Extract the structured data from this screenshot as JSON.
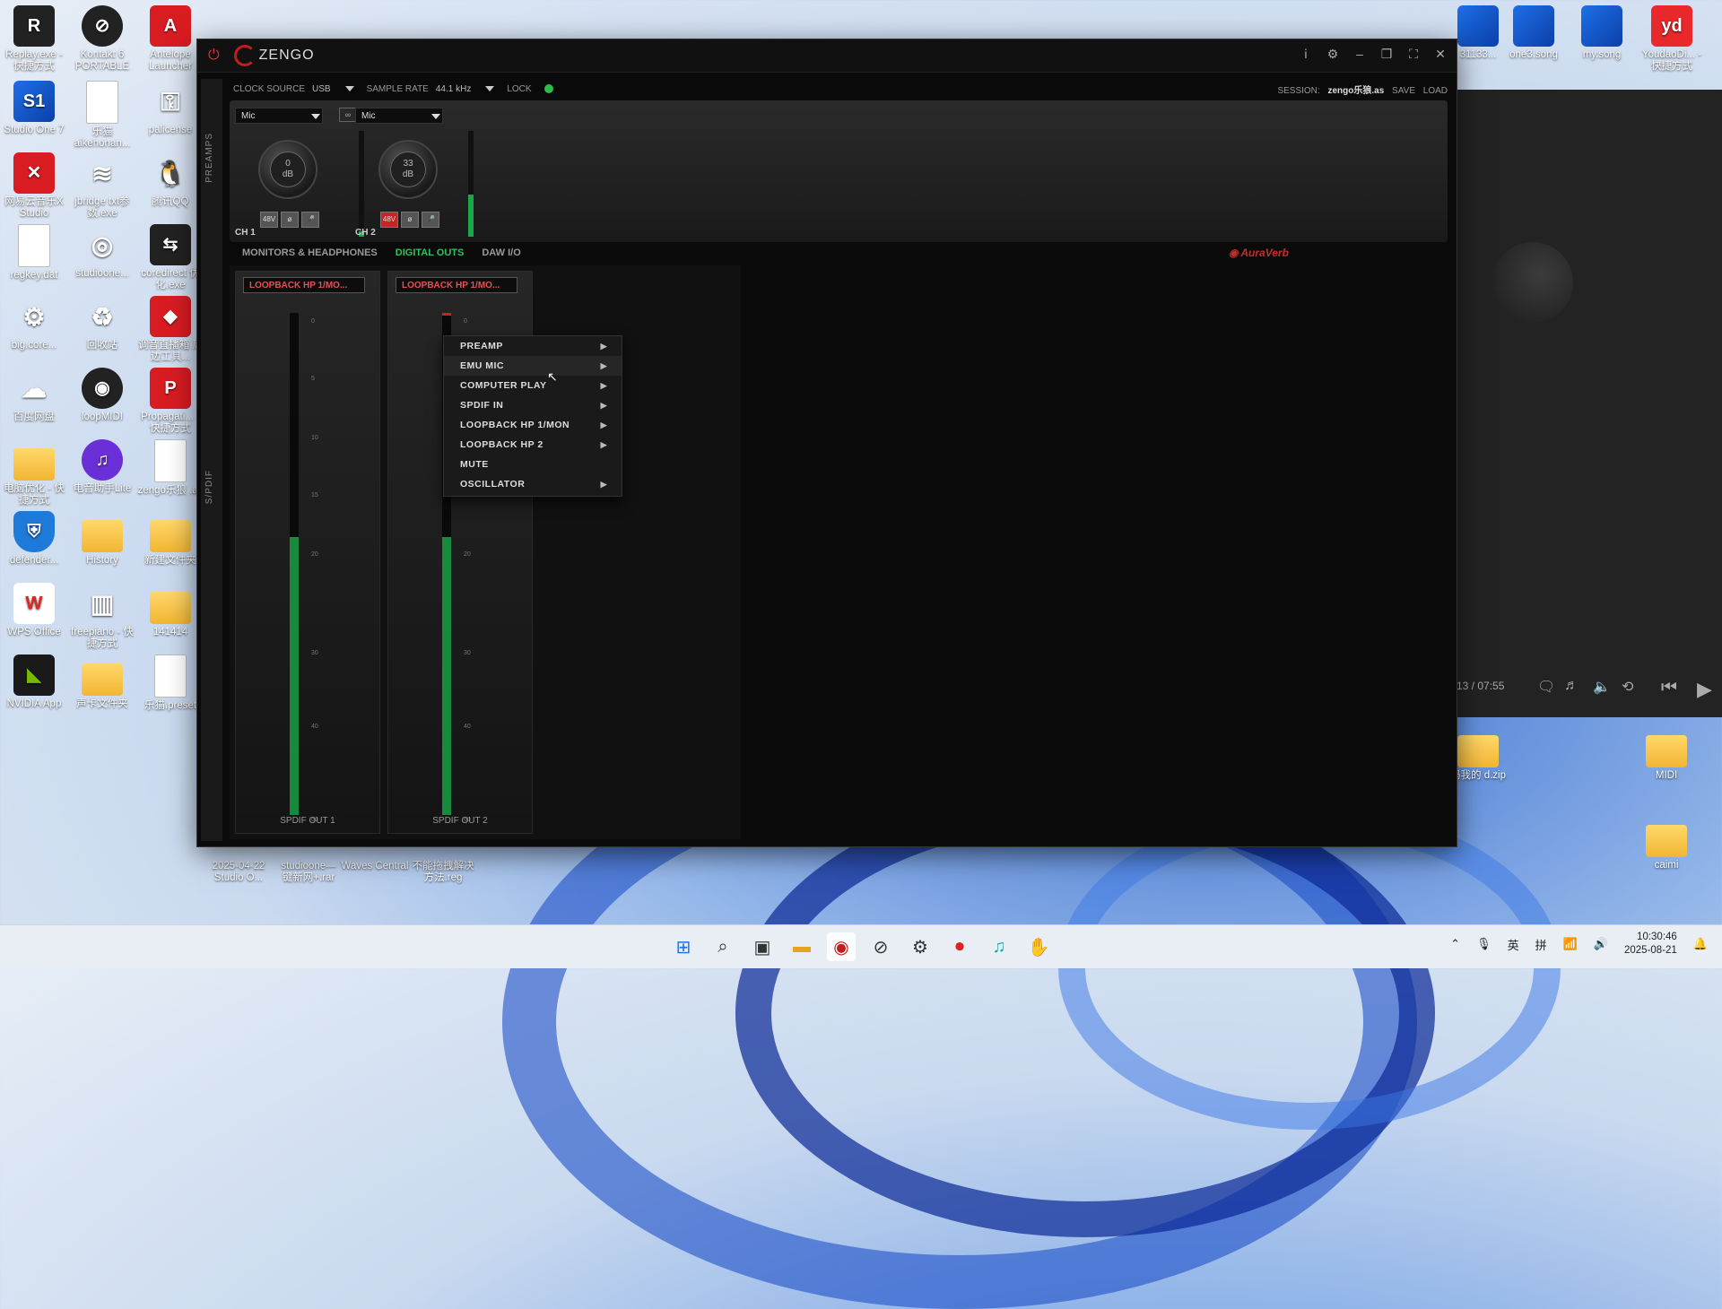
{
  "desktop": {
    "left_icons": [
      {
        "label": "Replay.exe - 快捷方式",
        "glyph": "R",
        "style": "dark-sq"
      },
      {
        "label": "Kontakt 6 PORTABLE",
        "glyph": "⊘",
        "style": "dark"
      },
      {
        "label": "Antelope Launcher",
        "glyph": "A",
        "style": "red"
      },
      {
        "label": "Studio One 7",
        "glyph": "S1",
        "style": "blue"
      },
      {
        "label": "乐猫 aikehonan...",
        "glyph": "",
        "style": "file"
      },
      {
        "label": "palicense",
        "glyph": "⚿",
        "style": "plain"
      },
      {
        "label": "网易云音乐X Studio",
        "glyph": "✕",
        "style": "red"
      },
      {
        "label": "jbridge txt参数.exe",
        "glyph": "≋",
        "style": "plain"
      },
      {
        "label": "腾讯QQ",
        "glyph": "🐧",
        "style": "plain"
      },
      {
        "label": "regkey.dat",
        "glyph": "",
        "style": "file"
      },
      {
        "label": "studioone...",
        "glyph": "◎",
        "style": "plain"
      },
      {
        "label": "coredirect 优化.exe",
        "glyph": "⇆",
        "style": "dark-sq"
      },
      {
        "label": "big.core...",
        "glyph": "⚙",
        "style": "plain"
      },
      {
        "label": "回收站",
        "glyph": "♻",
        "style": "plain"
      },
      {
        "label": "调音直播箱 周边工具...",
        "glyph": "◆",
        "style": "red"
      },
      {
        "label": "百度网盘",
        "glyph": "☁",
        "style": "plain"
      },
      {
        "label": "loopMIDI",
        "glyph": "◉",
        "style": "dark"
      },
      {
        "label": "Propagati... - 快捷方式",
        "glyph": "P",
        "style": "red"
      },
      {
        "label": "电脑优化 - 快捷方式",
        "glyph": "",
        "style": "folder"
      },
      {
        "label": "电音助手Lite",
        "glyph": "♫",
        "style": "purple"
      },
      {
        "label": "zengo乐狼 .as",
        "glyph": "",
        "style": "file"
      },
      {
        "label": "defender...",
        "glyph": "⛨",
        "style": "shield"
      },
      {
        "label": "History",
        "glyph": "",
        "style": "folder"
      },
      {
        "label": "新建文件夹",
        "glyph": "",
        "style": "folder"
      },
      {
        "label": "WPS Office",
        "glyph": "W",
        "style": "wps"
      },
      {
        "label": "freepiano - 快捷方式",
        "glyph": "▥",
        "style": "plain"
      },
      {
        "label": "141414",
        "glyph": "",
        "style": "folder"
      },
      {
        "label": "NVIDIA App",
        "glyph": "◣",
        "style": "green"
      },
      {
        "label": "声卡文件夹",
        "glyph": "",
        "style": "folder"
      },
      {
        "label": "乐猫.preset",
        "glyph": "",
        "style": "file"
      }
    ],
    "bottom_icons": [
      {
        "label": "2025-04-22 Studio O..."
      },
      {
        "label": "studioone— 键新网+.rar"
      },
      {
        "label": "Waves Central"
      },
      {
        "label": "不能拖拽解决 方法.reg"
      }
    ],
    "top_right_icons": [
      {
        "label": "31133..."
      },
      {
        "label": "one3.song"
      },
      {
        "label": "my.song"
      },
      {
        "label": "YoudaoDi... - 快捷方式"
      }
    ],
    "right_icons": [
      {
        "label": "码我的 d.zip"
      },
      {
        "label": "MIDI"
      },
      {
        "label": "caimi"
      }
    ]
  },
  "app": {
    "logo_text": "ZENGO",
    "topbar": {
      "clock_source_label": "CLOCK SOURCE",
      "clock_source_value": "USB",
      "sample_rate_label": "SAMPLE RATE",
      "sample_rate_value": "44.1 kHz",
      "lock_label": "LOCK",
      "session_label": "SESSION:",
      "session_name": "zengo乐狼.as",
      "save_label": "SAVE",
      "load_label": "LOAD"
    },
    "side_labels": {
      "preamps": "PREAMPS",
      "spdif": "S/PDIF"
    },
    "channels": [
      {
        "input": "Mic",
        "gain_value": "0",
        "gain_unit": "dB",
        "phantom": "48V",
        "phase": "ø",
        "mic": "🎤",
        "label": "CH 1",
        "phantom_on": false,
        "meter_level": 0.05
      },
      {
        "input": "Mic",
        "gain_value": "33",
        "gain_unit": "dB",
        "phantom": "48V",
        "phase": "ø",
        "mic": "🎤",
        "label": "CH 2",
        "phantom_on": true,
        "meter_level": 0.4
      }
    ],
    "link_icon": "∞",
    "tabs": [
      {
        "label": "MONITORS & HEADPHONES",
        "active": false
      },
      {
        "label": "DIGITAL OUTS",
        "active": true
      },
      {
        "label": "DAW I/O",
        "active": false
      }
    ],
    "auraverb_label": "AuraVerb",
    "outputs": [
      {
        "source": "LOOPBACK HP 1/MO...",
        "label": "SPDIF OUT 1"
      },
      {
        "source": "LOOPBACK HP 1/MO...",
        "label": "SPDIF OUT 2"
      }
    ],
    "meter_scale": [
      "0",
      "5",
      "10",
      "15",
      "20",
      "30",
      "40",
      "60"
    ],
    "context_menu": [
      {
        "label": "PREAMP",
        "submenu": true
      },
      {
        "label": "EMU MIC",
        "submenu": true
      },
      {
        "label": "COMPUTER PLAY",
        "submenu": true
      },
      {
        "label": "SPDIF IN",
        "submenu": true
      },
      {
        "label": "LOOPBACK HP 1/MON",
        "submenu": true
      },
      {
        "label": "LOOPBACK HP 2",
        "submenu": true
      },
      {
        "label": "MUTE",
        "submenu": false
      },
      {
        "label": "OSCILLATOR",
        "submenu": true
      }
    ]
  },
  "player": {
    "time": "13 / 07:55"
  },
  "taskbar": {
    "tray_lang1": "英",
    "tray_lang2": "拼",
    "time": "10:30:46",
    "date": "2025-08-21"
  },
  "colors": {
    "accent_green": "#2ec260",
    "accent_red": "#c92a2a"
  }
}
